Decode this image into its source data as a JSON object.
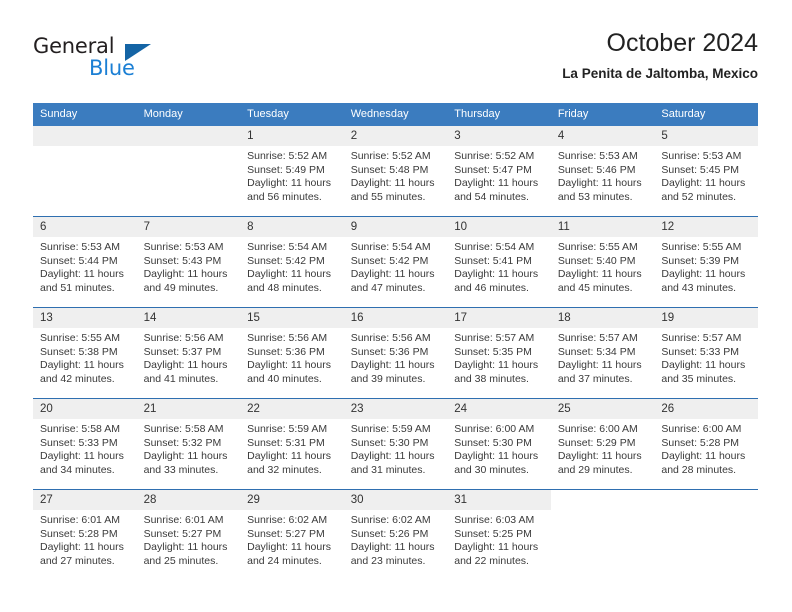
{
  "brand": {
    "name_dark": "General",
    "name_blue": "Blue",
    "accent_blue": "#1b7fd4",
    "triangle_blue": "#1464a5",
    "header_blue": "#3b7cbf"
  },
  "header": {
    "title": "October 2024",
    "subtitle": "La Penita de Jaltomba, Mexico"
  },
  "weekdays": [
    "Sunday",
    "Monday",
    "Tuesday",
    "Wednesday",
    "Thursday",
    "Friday",
    "Saturday"
  ],
  "labels": {
    "sunrise": "Sunrise:",
    "sunset": "Sunset:",
    "daylight": "Daylight:"
  },
  "weeks": [
    [
      {
        "day": "",
        "blank": true
      },
      {
        "day": "",
        "blank": true
      },
      {
        "day": "1",
        "sunrise": "Sunrise: 5:52 AM",
        "sunset": "Sunset: 5:49 PM",
        "daylight": "Daylight: 11 hours and 56 minutes."
      },
      {
        "day": "2",
        "sunrise": "Sunrise: 5:52 AM",
        "sunset": "Sunset: 5:48 PM",
        "daylight": "Daylight: 11 hours and 55 minutes."
      },
      {
        "day": "3",
        "sunrise": "Sunrise: 5:52 AM",
        "sunset": "Sunset: 5:47 PM",
        "daylight": "Daylight: 11 hours and 54 minutes."
      },
      {
        "day": "4",
        "sunrise": "Sunrise: 5:53 AM",
        "sunset": "Sunset: 5:46 PM",
        "daylight": "Daylight: 11 hours and 53 minutes."
      },
      {
        "day": "5",
        "sunrise": "Sunrise: 5:53 AM",
        "sunset": "Sunset: 5:45 PM",
        "daylight": "Daylight: 11 hours and 52 minutes."
      }
    ],
    [
      {
        "day": "6",
        "sunrise": "Sunrise: 5:53 AM",
        "sunset": "Sunset: 5:44 PM",
        "daylight": "Daylight: 11 hours and 51 minutes."
      },
      {
        "day": "7",
        "sunrise": "Sunrise: 5:53 AM",
        "sunset": "Sunset: 5:43 PM",
        "daylight": "Daylight: 11 hours and 49 minutes."
      },
      {
        "day": "8",
        "sunrise": "Sunrise: 5:54 AM",
        "sunset": "Sunset: 5:42 PM",
        "daylight": "Daylight: 11 hours and 48 minutes."
      },
      {
        "day": "9",
        "sunrise": "Sunrise: 5:54 AM",
        "sunset": "Sunset: 5:42 PM",
        "daylight": "Daylight: 11 hours and 47 minutes."
      },
      {
        "day": "10",
        "sunrise": "Sunrise: 5:54 AM",
        "sunset": "Sunset: 5:41 PM",
        "daylight": "Daylight: 11 hours and 46 minutes."
      },
      {
        "day": "11",
        "sunrise": "Sunrise: 5:55 AM",
        "sunset": "Sunset: 5:40 PM",
        "daylight": "Daylight: 11 hours and 45 minutes."
      },
      {
        "day": "12",
        "sunrise": "Sunrise: 5:55 AM",
        "sunset": "Sunset: 5:39 PM",
        "daylight": "Daylight: 11 hours and 43 minutes."
      }
    ],
    [
      {
        "day": "13",
        "sunrise": "Sunrise: 5:55 AM",
        "sunset": "Sunset: 5:38 PM",
        "daylight": "Daylight: 11 hours and 42 minutes."
      },
      {
        "day": "14",
        "sunrise": "Sunrise: 5:56 AM",
        "sunset": "Sunset: 5:37 PM",
        "daylight": "Daylight: 11 hours and 41 minutes."
      },
      {
        "day": "15",
        "sunrise": "Sunrise: 5:56 AM",
        "sunset": "Sunset: 5:36 PM",
        "daylight": "Daylight: 11 hours and 40 minutes."
      },
      {
        "day": "16",
        "sunrise": "Sunrise: 5:56 AM",
        "sunset": "Sunset: 5:36 PM",
        "daylight": "Daylight: 11 hours and 39 minutes."
      },
      {
        "day": "17",
        "sunrise": "Sunrise: 5:57 AM",
        "sunset": "Sunset: 5:35 PM",
        "daylight": "Daylight: 11 hours and 38 minutes."
      },
      {
        "day": "18",
        "sunrise": "Sunrise: 5:57 AM",
        "sunset": "Sunset: 5:34 PM",
        "daylight": "Daylight: 11 hours and 37 minutes."
      },
      {
        "day": "19",
        "sunrise": "Sunrise: 5:57 AM",
        "sunset": "Sunset: 5:33 PM",
        "daylight": "Daylight: 11 hours and 35 minutes."
      }
    ],
    [
      {
        "day": "20",
        "sunrise": "Sunrise: 5:58 AM",
        "sunset": "Sunset: 5:33 PM",
        "daylight": "Daylight: 11 hours and 34 minutes."
      },
      {
        "day": "21",
        "sunrise": "Sunrise: 5:58 AM",
        "sunset": "Sunset: 5:32 PM",
        "daylight": "Daylight: 11 hours and 33 minutes."
      },
      {
        "day": "22",
        "sunrise": "Sunrise: 5:59 AM",
        "sunset": "Sunset: 5:31 PM",
        "daylight": "Daylight: 11 hours and 32 minutes."
      },
      {
        "day": "23",
        "sunrise": "Sunrise: 5:59 AM",
        "sunset": "Sunset: 5:30 PM",
        "daylight": "Daylight: 11 hours and 31 minutes."
      },
      {
        "day": "24",
        "sunrise": "Sunrise: 6:00 AM",
        "sunset": "Sunset: 5:30 PM",
        "daylight": "Daylight: 11 hours and 30 minutes."
      },
      {
        "day": "25",
        "sunrise": "Sunrise: 6:00 AM",
        "sunset": "Sunset: 5:29 PM",
        "daylight": "Daylight: 11 hours and 29 minutes."
      },
      {
        "day": "26",
        "sunrise": "Sunrise: 6:00 AM",
        "sunset": "Sunset: 5:28 PM",
        "daylight": "Daylight: 11 hours and 28 minutes."
      }
    ],
    [
      {
        "day": "27",
        "sunrise": "Sunrise: 6:01 AM",
        "sunset": "Sunset: 5:28 PM",
        "daylight": "Daylight: 11 hours and 27 minutes."
      },
      {
        "day": "28",
        "sunrise": "Sunrise: 6:01 AM",
        "sunset": "Sunset: 5:27 PM",
        "daylight": "Daylight: 11 hours and 25 minutes."
      },
      {
        "day": "29",
        "sunrise": "Sunrise: 6:02 AM",
        "sunset": "Sunset: 5:27 PM",
        "daylight": "Daylight: 11 hours and 24 minutes."
      },
      {
        "day": "30",
        "sunrise": "Sunrise: 6:02 AM",
        "sunset": "Sunset: 5:26 PM",
        "daylight": "Daylight: 11 hours and 23 minutes."
      },
      {
        "day": "31",
        "sunrise": "Sunrise: 6:03 AM",
        "sunset": "Sunset: 5:25 PM",
        "daylight": "Daylight: 11 hours and 22 minutes."
      },
      {
        "day": "",
        "blank": true
      },
      {
        "day": "",
        "blank": true
      }
    ]
  ]
}
